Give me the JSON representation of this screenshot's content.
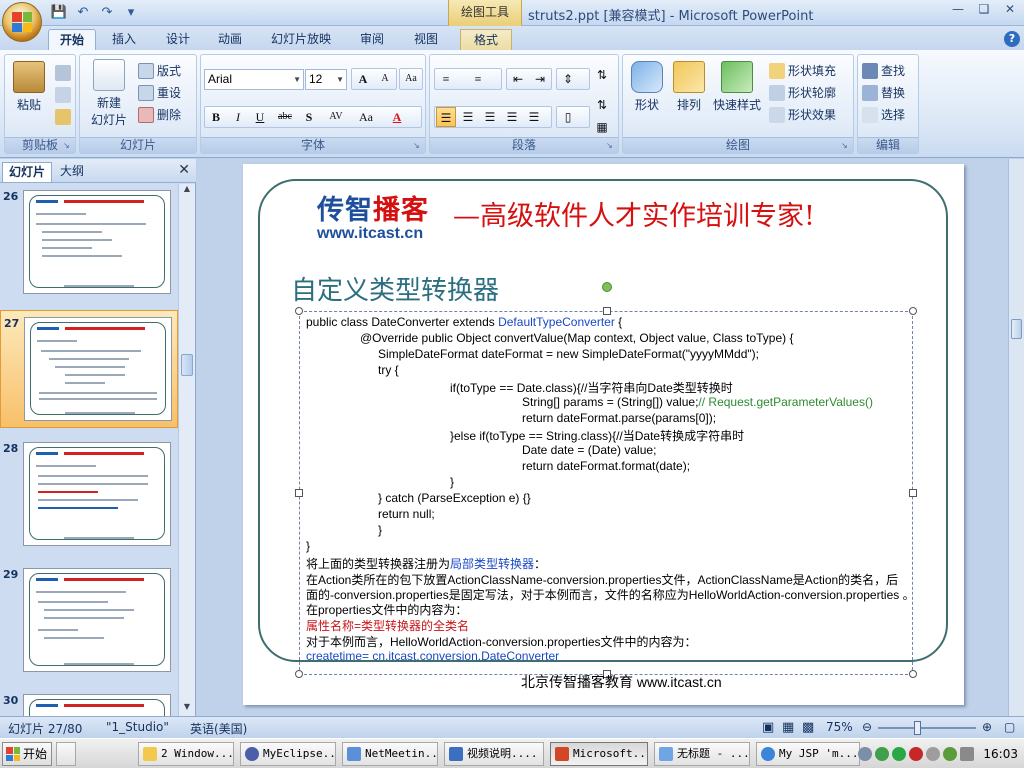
{
  "window": {
    "title": "struts2.ppt [兼容模式] - Microsoft PowerPoint",
    "context_tab_group": "绘图工具"
  },
  "quick_access": [
    "save-icon",
    "undo-icon",
    "redo-icon",
    "customize-icon"
  ],
  "ribbon_tabs": [
    "开始",
    "插入",
    "设计",
    "动画",
    "幻灯片放映",
    "审阅",
    "视图",
    "格式"
  ],
  "active_tab": "开始",
  "ribbon": {
    "clipboard": {
      "label": "剪贴板",
      "paste": "粘贴"
    },
    "slides": {
      "label": "幻灯片",
      "new_slide_line1": "新建",
      "new_slide_line2": "幻灯片",
      "layout": "版式",
      "reset": "重设",
      "delete": "删除"
    },
    "font": {
      "label": "字体",
      "font_name": "Arial",
      "font_size": "12",
      "grow": "A",
      "shrink": "A",
      "clear": "Aa",
      "bold": "B",
      "italic": "I",
      "underline": "U",
      "strike": "abc",
      "shadow": "S",
      "spacing": "AV",
      "case": "Aa",
      "color": "A"
    },
    "paragraph": {
      "label": "段落"
    },
    "drawing": {
      "label": "绘图",
      "shape": "形状",
      "arrange": "排列",
      "quick_styles": "快速样式",
      "fill": "形状填充",
      "outline": "形状轮廓",
      "effects": "形状效果"
    },
    "editing": {
      "label": "编辑",
      "find": "查找",
      "replace": "替换",
      "select": "选择"
    }
  },
  "panel": {
    "tab_slides": "幻灯片",
    "tab_outline": "大纲"
  },
  "thumbnails": [
    {
      "number": "26",
      "selected": false
    },
    {
      "number": "27",
      "selected": true
    },
    {
      "number": "28",
      "selected": false
    },
    {
      "number": "29",
      "selected": false
    },
    {
      "number": "30",
      "selected": false
    }
  ],
  "slide": {
    "brand_part1": "传智",
    "brand_part2": "播客",
    "brand_url": "www.itcast.cn",
    "slogan": "—高级软件人才实作培训专家!",
    "title": "自定义类型转换器",
    "footer": "北京传智播客教育 www.itcast.cn",
    "code": [
      {
        "pre": "public class DateConverter extends ",
        "hl": "DefaultTypeConverter",
        "post": " {"
      },
      {
        "pre": "@Override   public Object convertValue(Map context, Object value, Class toType) {",
        "hl": "",
        "post": ""
      },
      {
        "pre": "SimpleDateFormat dateFormat = new SimpleDateFormat(\"yyyyMMdd\");",
        "hl": "",
        "post": ""
      },
      {
        "pre": "try {",
        "hl": "",
        "post": ""
      },
      {
        "pre": "if(toType == Date.class){//当字符串向Date类型转换时",
        "hl": "",
        "post": ""
      },
      {
        "pre": "String[] params = (String[]) value;",
        "hl": "// Request.getParameterValues()",
        "post": ""
      },
      {
        "pre": "return dateFormat.parse(params[0]);",
        "hl": "",
        "post": ""
      },
      {
        "pre": "}else if(toType == String.class){//当Date转换成字符串时",
        "hl": "",
        "post": ""
      },
      {
        "pre": "Date date = (Date) value;",
        "hl": "",
        "post": ""
      },
      {
        "pre": "return dateFormat.format(date);",
        "hl": "",
        "post": ""
      },
      {
        "pre": "}",
        "hl": "",
        "post": ""
      },
      {
        "pre": "} catch (ParseException e) {}",
        "hl": "",
        "post": ""
      },
      {
        "pre": "return null;",
        "hl": "",
        "post": ""
      },
      {
        "pre": "}",
        "hl": "",
        "post": ""
      },
      {
        "pre": "}",
        "hl": "",
        "post": ""
      }
    ],
    "register_pre": "将上面的类型转换器注册为",
    "register_hl": "局部类型转换器",
    "register_post": "：",
    "desc1": "在Action类所在的包下放置ActionClassName-conversion.properties文件，ActionClassName是Action的类名，后",
    "desc2": "面的-conversion.properties是固定写法，对于本例而言，文件的名称应为HelloWorldAction-conversion.properties 。",
    "desc3": "在properties文件中的内容为：",
    "desc4": "属性名称=类型转换器的全类名",
    "desc5": "对于本例而言，HelloWorldAction-conversion.properties文件中的内容为：",
    "desc6": "createtime= cn.itcast.conversion.DateConverter"
  },
  "status": {
    "slide_info": "幻灯片 27/80",
    "theme": "\"1_Studio\"",
    "language": "英语(美国)",
    "zoom": "75%",
    "zoom_level": 0.4
  },
  "taskbar": {
    "start": "开始",
    "tasks": [
      "2 Window...",
      "MyEclipse...",
      "NetMeetin...",
      "视频说明....",
      "Microsoft...",
      "无标题 - ...",
      "My JSP 'm..."
    ],
    "active_task": 4,
    "clock": "16:03"
  },
  "colors": {
    "accent_red": "#d60f0f",
    "brand_blue": "#1d4f9c",
    "code_green": "#2e8b2e",
    "code_blue": "#1a48c4",
    "title_teal": "#2c6f80",
    "selection_orange": "#f8c06a"
  }
}
